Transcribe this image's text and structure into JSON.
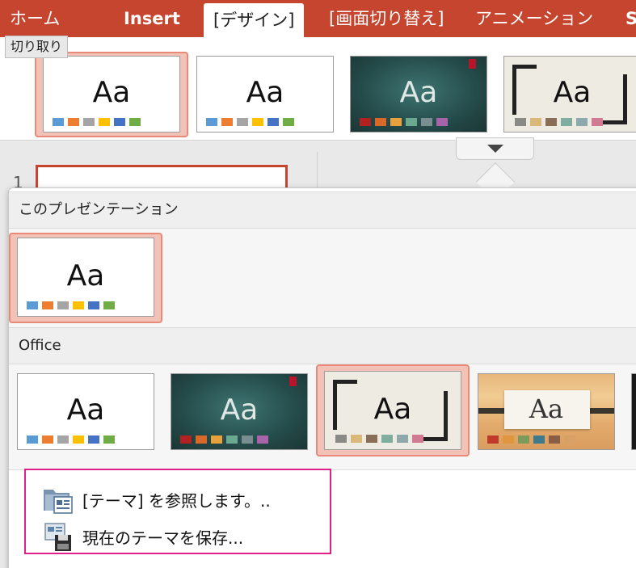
{
  "ribbon": {
    "tabs": [
      "ホーム",
      "Insert",
      "[デザイン]",
      "[画面切り替え]",
      "アニメーション",
      "S"
    ],
    "active_tab_index": 2,
    "tooltip": "切り取り",
    "accent": "#c6452e"
  },
  "slide_panel": {
    "slide_number": "1"
  },
  "theme_strip": {
    "thumbnails": [
      {
        "style": "office-selected",
        "sample": "Aa"
      },
      {
        "style": "office",
        "sample": "Aa"
      },
      {
        "style": "dark-teal",
        "sample": "Aa"
      },
      {
        "style": "framed",
        "sample": "Aa"
      }
    ]
  },
  "dropdown": {
    "this_presentation_label": "このプレゼンテーション",
    "this_presentation_sample": "Aa",
    "office_label": "Office",
    "office_samples": [
      "Aa",
      "Aa",
      "Aa",
      "Aa"
    ],
    "browse_themes_label": "[テーマ] を参照します。..",
    "save_theme_label": "現在のテーマを保存..."
  },
  "icons": [
    "dropdown-arrow-icon",
    "folder-browse-icon",
    "save-theme-icon"
  ],
  "swatch_colors": {
    "office": [
      "#5b9bd5",
      "#ed7d31",
      "#a5a5a5",
      "#ffc000",
      "#4472c4",
      "#70ad47"
    ],
    "dark": [
      "#b0211f",
      "#d8692a",
      "#e9a23b",
      "#6aa98f",
      "#7a8d8f",
      "#a864a8"
    ],
    "framed": [
      "#8a8a86",
      "#d9b87a",
      "#8b6e58",
      "#7fae9f",
      "#8ea9ad",
      "#d27a93"
    ],
    "wood": [
      "#c0392b",
      "#e0963c",
      "#7c9a5b",
      "#3e7a8a",
      "#8a5e46",
      "#d9a066"
    ]
  }
}
